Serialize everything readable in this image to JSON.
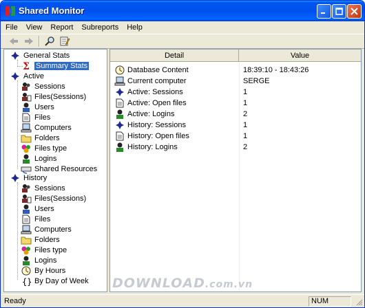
{
  "window": {
    "title": "Shared Monitor"
  },
  "menu": [
    "File",
    "View",
    "Report",
    "Subreports",
    "Help"
  ],
  "toolbar": {
    "buttons": [
      "back-arrow-icon",
      "forward-arrow-icon",
      "find-icon",
      "notepad-edit-icon"
    ]
  },
  "tree": {
    "general_label": "General Stats",
    "summary_label": "Summary Stats",
    "active_label": "Active",
    "active_items": [
      "Sessions",
      "Files(Sessions)",
      "Users",
      "Files",
      "Computers",
      "Folders",
      "Files type",
      "Logins",
      "Shared Resources"
    ],
    "history_label": "History",
    "history_items": [
      "Sessions",
      "Files(Sessions)",
      "Users",
      "Files",
      "Computers",
      "Folders",
      "Files type",
      "Logins",
      "By Hours",
      "By Day of Week"
    ]
  },
  "grid": {
    "columns": [
      "Detail",
      "Value"
    ],
    "rows": [
      {
        "detail": "Database Content",
        "value": "18:39:10 - 18:43:26",
        "icon": "clock-icon"
      },
      {
        "detail": "Current computer",
        "value": "SERGE",
        "icon": "computer-icon"
      },
      {
        "detail": "Active: Sessions",
        "value": "1",
        "icon": "session-star-icon"
      },
      {
        "detail": "Active: Open files",
        "value": "1",
        "icon": "document-icon"
      },
      {
        "detail": "Active: Logins",
        "value": "2",
        "icon": "user-icon"
      },
      {
        "detail": "History: Sessions",
        "value": "1",
        "icon": "session-star-icon"
      },
      {
        "detail": "History: Open files",
        "value": "1",
        "icon": "document-icon"
      },
      {
        "detail": "History: Logins",
        "value": "2",
        "icon": "user-icon"
      }
    ]
  },
  "watermark": {
    "main": "DOWNLOAD",
    "suffix": ".com.vn"
  },
  "status": {
    "text": "Ready",
    "num": "NUM"
  },
  "colors": {
    "selection": "#316ac5",
    "title_blue": "#0053ee"
  }
}
